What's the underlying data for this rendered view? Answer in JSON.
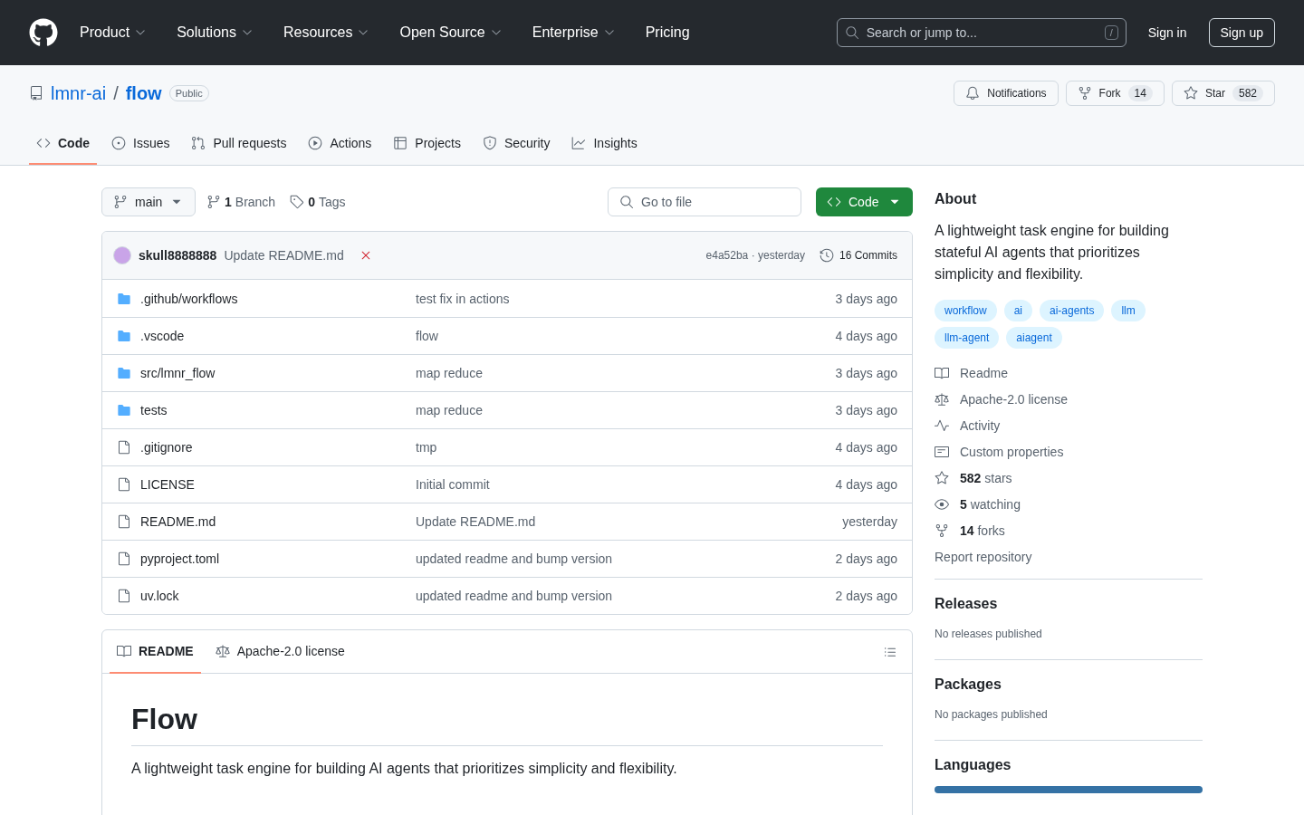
{
  "top_nav": {
    "items": [
      {
        "label": "Product",
        "dropdown": true
      },
      {
        "label": "Solutions",
        "dropdown": true
      },
      {
        "label": "Resources",
        "dropdown": true
      },
      {
        "label": "Open Source",
        "dropdown": true
      },
      {
        "label": "Enterprise",
        "dropdown": true
      },
      {
        "label": "Pricing",
        "dropdown": false
      }
    ],
    "search": {
      "placeholder": "Search or jump to...",
      "shortcut": "/"
    },
    "sign_in": "Sign in",
    "sign_up": "Sign up"
  },
  "repo": {
    "owner": "lmnr-ai",
    "separator": "/",
    "name": "flow",
    "visibility": "Public",
    "actions": [
      {
        "kind": "notifications",
        "label": "Notifications"
      },
      {
        "kind": "fork",
        "label": "Fork",
        "count": "14"
      },
      {
        "kind": "star",
        "label": "Star",
        "count": "582"
      }
    ]
  },
  "tabs": [
    {
      "label": "Code",
      "selected": true
    },
    {
      "label": "Issues",
      "selected": false
    },
    {
      "label": "Pull requests",
      "selected": false
    },
    {
      "label": "Actions",
      "selected": false
    },
    {
      "label": "Projects",
      "selected": false
    },
    {
      "label": "Security",
      "selected": false
    },
    {
      "label": "Insights",
      "selected": false
    }
  ],
  "toolbar": {
    "branch": "main",
    "branch_count": "1",
    "branch_label": "Branch",
    "tag_count": "0",
    "tag_label": "Tags",
    "go_to_file": "Go to file",
    "code_button": "Code"
  },
  "latest_commit": {
    "author": "skull8888888",
    "message": "Update README.md",
    "checks_failed": true,
    "hash": "e4a52ba · yesterday",
    "commits": "16 Commits"
  },
  "files": [
    {
      "kind": "dir",
      "name": ".github/workflows",
      "message": "test fix in actions",
      "time": "3 days ago"
    },
    {
      "kind": "dir",
      "name": ".vscode",
      "message": "flow",
      "time": "4 days ago"
    },
    {
      "kind": "dir",
      "name": "src/lmnr_flow",
      "message": "map reduce",
      "time": "3 days ago"
    },
    {
      "kind": "dir",
      "name": "tests",
      "message": "map reduce",
      "time": "3 days ago"
    },
    {
      "kind": "file",
      "name": ".gitignore",
      "message": "tmp",
      "time": "4 days ago"
    },
    {
      "kind": "file",
      "name": "LICENSE",
      "message": "Initial commit",
      "time": "4 days ago"
    },
    {
      "kind": "file",
      "name": "README.md",
      "message": "Update README.md",
      "time": "yesterday"
    },
    {
      "kind": "file",
      "name": "pyproject.toml",
      "message": "updated readme and bump version",
      "time": "2 days ago"
    },
    {
      "kind": "file",
      "name": "uv.lock",
      "message": "updated readme and bump version",
      "time": "2 days ago"
    }
  ],
  "readme": {
    "tabs": [
      {
        "label": "README",
        "selected": true
      },
      {
        "label": "Apache-2.0 license",
        "selected": false
      }
    ],
    "title": "Flow",
    "text": "A lightweight task engine for building AI agents that prioritizes simplicity and flexibility."
  },
  "about": {
    "title": "About",
    "description": "A lightweight task engine for building stateful AI agents that prioritizes simplicity and flexibility.",
    "topics": [
      "workflow",
      "ai",
      "ai-agents",
      "llm",
      "llm-agent",
      "aiagent"
    ],
    "links": [
      {
        "text": "Readme"
      },
      {
        "text": "Apache-2.0 license"
      },
      {
        "text": "Activity"
      },
      {
        "text": "Custom properties"
      },
      {
        "count": "582",
        "text": "stars"
      },
      {
        "count": "5",
        "text": "watching"
      },
      {
        "count": "14",
        "text": "forks"
      }
    ],
    "report": "Report repository"
  },
  "sections": [
    {
      "title": "Releases",
      "note": "No releases published"
    },
    {
      "title": "Packages",
      "note": "No packages published"
    },
    {
      "title": "Languages"
    }
  ]
}
